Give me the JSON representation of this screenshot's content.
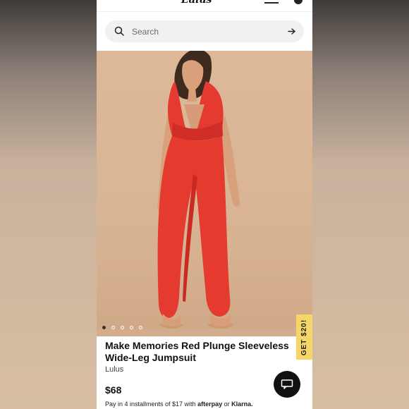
{
  "search": {
    "placeholder": "Search"
  },
  "product": {
    "title": "Make Memories Red Plunge Sleeveless Wide-Leg Jumpsuit",
    "brand": "Lulus",
    "price": "$68",
    "installments_prefix": "Pay in 4 installments of $17 with",
    "installments_provider_1": "afterpay",
    "installments_or": "or",
    "installments_provider_2": "Klarna."
  },
  "promo": {
    "label": "GET $20!"
  },
  "gallery": {
    "total_images": 5,
    "active_index": 1
  },
  "icons": {
    "search": "search-icon",
    "arrow": "arrow-right-icon",
    "chat": "chat-icon",
    "menu": "hamburger-icon",
    "bag": "bag-icon"
  },
  "colors": {
    "promo_tab": "#f6d668",
    "dress": "#e53a2f",
    "chat_button": "#111111"
  }
}
